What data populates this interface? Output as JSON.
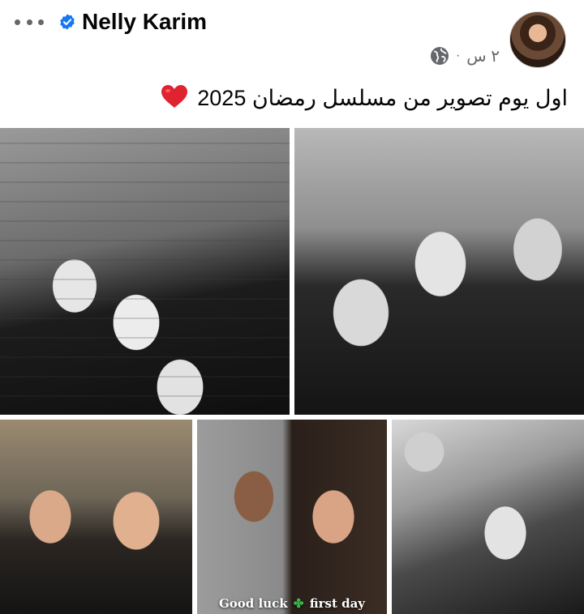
{
  "post": {
    "author_name": "Nelly Karim",
    "time_ago": "٢ س",
    "separator": "·",
    "text": "اول يوم تصوير من مسلسل رمضان 2025",
    "photo_overlay_text_left": "Good luck",
    "photo_overlay_text_right": "first day"
  },
  "icons": {
    "more": "more-horizontal-icon",
    "verified": "verified-badge-icon",
    "privacy": "globe-icon",
    "emoji": "red-heart-icon",
    "overlay_emoji": "four-leaf-clover-icon"
  },
  "colors": {
    "verified_blue": "#1877f2",
    "heart_red": "#e0242f",
    "meta_gray": "#65676b",
    "text_dark": "#050505"
  }
}
